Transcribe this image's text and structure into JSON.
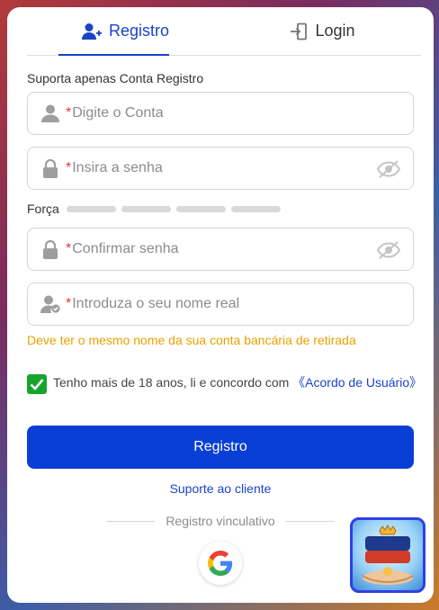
{
  "tabs": [
    {
      "label": "Registro",
      "active": true,
      "icon": "add-user-icon"
    },
    {
      "label": "Login",
      "active": false,
      "icon": "login-door-icon"
    }
  ],
  "note": "Suporta apenas Conta Registro",
  "fields": {
    "account": {
      "placeholder": "Digite o Conta",
      "required_mark": "*",
      "icon": "user-icon"
    },
    "password": {
      "placeholder": "Insira a senha",
      "required_mark": "*",
      "icon": "lock-icon"
    },
    "confirm": {
      "placeholder": "Confirmar senha",
      "required_mark": "*",
      "icon": "lock-icon"
    },
    "realname": {
      "placeholder": "Introduza o seu nome real",
      "required_mark": "*",
      "icon": "user-check-icon"
    }
  },
  "strength": {
    "label": "Força",
    "level": 0,
    "segments": 4
  },
  "realname_hint": "Deve ter o mesmo nome da sua conta bancária de retirada",
  "agreement": {
    "checked": true,
    "text": "Tenho mais de 18 anos, li e concordo com ",
    "link": "《Acordo de Usuário》"
  },
  "submit_label": "Registro",
  "support_link": "Suporte ao cliente",
  "divider_text": "Registro vinculativo",
  "social": [
    {
      "name": "google-icon"
    }
  ],
  "promo_badge": {
    "icon": "due777-logo-icon"
  },
  "colors": {
    "primary": "#0a3fd6",
    "tab_active": "#1a43c8",
    "hint": "#e9a100",
    "checkbox": "#16a52c",
    "required": "#e53935"
  }
}
